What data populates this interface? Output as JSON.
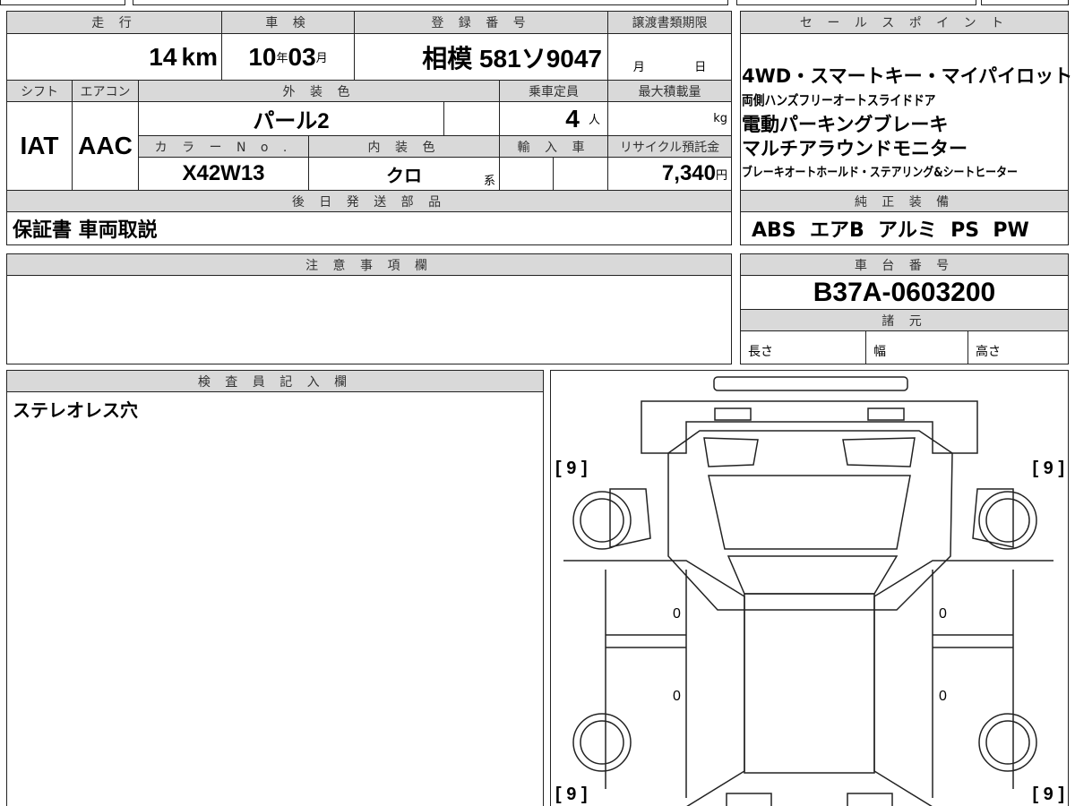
{
  "main": {
    "mileage_label": "走 行",
    "mileage_value": "14",
    "mileage_unit": "km",
    "inspection_label": "車 検",
    "inspection_year": "10",
    "year_unit": "年",
    "inspection_month": "03",
    "month_unit": "月",
    "registration_label": "登 録 番 号",
    "registration_value": "相模 581ソ9047",
    "transfer_deadline_label": "譲渡書類期限",
    "transfer_month_unit": "月",
    "transfer_day_unit": "日",
    "shift_label": "シフト",
    "shift_value": "IAT",
    "aircon_label": "エアコン",
    "aircon_value": "AAC",
    "exterior_color_label": "外 装 色",
    "exterior_color_value": "パール2",
    "capacity_label": "乗車定員",
    "capacity_value": "4",
    "capacity_unit": "人",
    "max_load_label": "最大積載量",
    "max_load_unit": "kg",
    "color_no_label": "カ ラ ー N o .",
    "color_no_value": "X42W13",
    "interior_color_label": "内 装 色",
    "interior_color_value": "クロ",
    "interior_suffix": "系",
    "import_label": "輸 入 車",
    "recycle_label": "リサイクル預託金",
    "recycle_value": "7,340",
    "recycle_unit": "円",
    "later_parts_label": "後 日 発 送 部 品",
    "later_parts_value": "保証書 車両取説"
  },
  "sales_points": {
    "label": "セ ー ル ス ポ イ ン ト",
    "lines": [
      "4WD・スマートキー・マイパイロット",
      "両側ハンズフリーオートスライドドア",
      "電動パーキングブレーキ",
      "マルチアラウンドモニター",
      "ブレーキオートホールド・ステアリング&シートヒーター"
    ]
  },
  "equipment": {
    "label": "純 正 装 備",
    "value": "ABS  エアB  アルミ  PS  PW"
  },
  "notes": {
    "label": "注 意 事 項 欄"
  },
  "chassis": {
    "label": "車 台 番 号",
    "value": "B37A-0603200",
    "spec_label": "諸 元",
    "length": "長さ",
    "width": "幅",
    "height": "高さ"
  },
  "inspector": {
    "label": "検 査 員 記 入 欄",
    "value": "ステレオレス穴"
  },
  "diagram": {
    "tire_fl": "[ 9 ]",
    "tire_fr": "[ 9 ]",
    "tire_rl": "[ 9 ]",
    "tire_rr": "[ 9 ]",
    "mark_l1": "0",
    "mark_l2": "0",
    "mark_r1": "0",
    "mark_r2": "0"
  }
}
